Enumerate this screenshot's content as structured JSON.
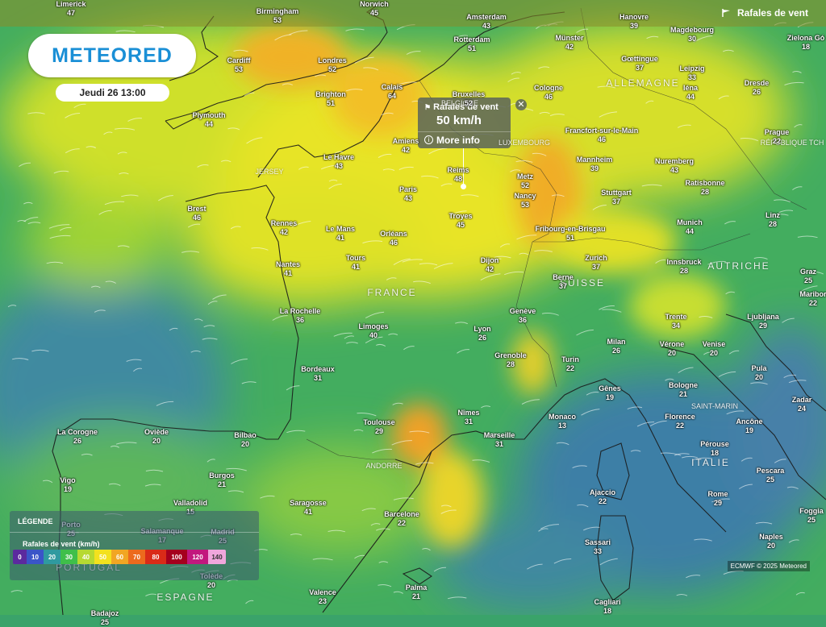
{
  "brand": "METEORED",
  "date_label": "Jeudi 26 13:00",
  "layer_label": "Rafales de vent",
  "tooltip": {
    "title": "Rafales de vent",
    "value": "50 km/h",
    "more": "More info"
  },
  "legend": {
    "title": "LÉGENDE",
    "subtitle": "Rafales de vent (km/h)",
    "scale": [
      {
        "label": "0",
        "color": "#5b2a9e"
      },
      {
        "label": "10",
        "color": "#3a55c8"
      },
      {
        "label": "20",
        "color": "#2f9aa0"
      },
      {
        "label": "30",
        "color": "#3fbf4a"
      },
      {
        "label": "40",
        "color": "#b6d931"
      },
      {
        "label": "50",
        "color": "#f3e11e"
      },
      {
        "label": "60",
        "color": "#f1a623"
      },
      {
        "label": "70",
        "color": "#ec6a1d"
      },
      {
        "label": "80",
        "color": "#d92b18"
      },
      {
        "label": "100",
        "color": "#a5001e"
      },
      {
        "label": "120",
        "color": "#c2187e"
      },
      {
        "label": "140",
        "color": "#f0a6dc"
      }
    ]
  },
  "credit": "ECMWF © 2025 Meteored",
  "countries": [
    "ALLEMAGNE",
    "FRANCE",
    "SUISSE",
    "AUTRICHE",
    "ITALIE",
    "ESPAGNE",
    "PORTUGAL",
    "RÉPUBLIQUE TCH",
    "LUXEMBOURG",
    "JERSEY",
    "ANDORRE",
    "SAINT-MARIN",
    "BELGIQUE"
  ],
  "cities": [
    {
      "name": "Limerick",
      "value": "47"
    },
    {
      "name": "Birmingham",
      "value": "53"
    },
    {
      "name": "Norwich",
      "value": "45"
    },
    {
      "name": "Amsterdam",
      "value": "43"
    },
    {
      "name": "Hanovre",
      "value": "39"
    },
    {
      "name": "Magdebourg",
      "value": "30"
    },
    {
      "name": "Zielona Gó",
      "value": "18"
    },
    {
      "name": "Cardiff",
      "value": "53"
    },
    {
      "name": "Londres",
      "value": "52"
    },
    {
      "name": "Rotterdam",
      "value": "51"
    },
    {
      "name": "Münster",
      "value": "42"
    },
    {
      "name": "Gœttingue",
      "value": "37"
    },
    {
      "name": "Leipzig",
      "value": "33"
    },
    {
      "name": "Dresde",
      "value": "26"
    },
    {
      "name": "Plymouth",
      "value": "44"
    },
    {
      "name": "Brighton",
      "value": "51"
    },
    {
      "name": "Calais",
      "value": "64"
    },
    {
      "name": "Bruxelles",
      "value": "52"
    },
    {
      "name": "Cologne",
      "value": "46"
    },
    {
      "name": "Iéna",
      "value": "44"
    },
    {
      "name": "Prague",
      "value": "22"
    },
    {
      "name": "Amiens",
      "value": "42"
    },
    {
      "name": "Francfort-sur-le-Main",
      "value": "46"
    },
    {
      "name": "Le Havre",
      "value": "43"
    },
    {
      "name": "Reims",
      "value": "48"
    },
    {
      "name": "Mannheim",
      "value": "39"
    },
    {
      "name": "Nuremberg",
      "value": "43"
    },
    {
      "name": "Metz",
      "value": "52"
    },
    {
      "name": "Ratisbonne",
      "value": "28"
    },
    {
      "name": "Brest",
      "value": "46"
    },
    {
      "name": "Paris",
      "value": "43"
    },
    {
      "name": "Nancy",
      "value": "53"
    },
    {
      "name": "Stuttgart",
      "value": "37"
    },
    {
      "name": "Linz",
      "value": "28"
    },
    {
      "name": "Rennes",
      "value": "42"
    },
    {
      "name": "Le Mans",
      "value": "41"
    },
    {
      "name": "Orléans",
      "value": "46"
    },
    {
      "name": "Troyes",
      "value": "45"
    },
    {
      "name": "Fribourg-en-Brisgau",
      "value": "51"
    },
    {
      "name": "Munich",
      "value": "44"
    },
    {
      "name": "Nantes",
      "value": "41"
    },
    {
      "name": "Tours",
      "value": "41"
    },
    {
      "name": "Dijon",
      "value": "42"
    },
    {
      "name": "Zurich",
      "value": "37"
    },
    {
      "name": "Innsbruck",
      "value": "28"
    },
    {
      "name": "Graz",
      "value": "25"
    },
    {
      "name": "Berne",
      "value": "37"
    },
    {
      "name": "Maribor",
      "value": "22"
    },
    {
      "name": "La Rochelle",
      "value": "36"
    },
    {
      "name": "Genève",
      "value": "36"
    },
    {
      "name": "Trente",
      "value": "34"
    },
    {
      "name": "Ljubljana",
      "value": "29"
    },
    {
      "name": "Limoges",
      "value": "40"
    },
    {
      "name": "Lyon",
      "value": "26"
    },
    {
      "name": "Milan",
      "value": "26"
    },
    {
      "name": "Vérone",
      "value": "20"
    },
    {
      "name": "Venise",
      "value": "20"
    },
    {
      "name": "Grenoble",
      "value": "28"
    },
    {
      "name": "Bordeaux",
      "value": "31"
    },
    {
      "name": "Turin",
      "value": "22"
    },
    {
      "name": "Pula",
      "value": "20"
    },
    {
      "name": "Gênes",
      "value": "19"
    },
    {
      "name": "Bologne",
      "value": "21"
    },
    {
      "name": "Zadar",
      "value": "24"
    },
    {
      "name": "Nîmes",
      "value": "31"
    },
    {
      "name": "Monaco",
      "value": "13"
    },
    {
      "name": "Florence",
      "value": "22"
    },
    {
      "name": "Ancône",
      "value": "19"
    },
    {
      "name": "La Corogne",
      "value": "26"
    },
    {
      "name": "Oviède",
      "value": "20"
    },
    {
      "name": "Toulouse",
      "value": "29"
    },
    {
      "name": "Marseille",
      "value": "31"
    },
    {
      "name": "Bilbao",
      "value": "20"
    },
    {
      "name": "Pérouse",
      "value": "18"
    },
    {
      "name": "Vigo",
      "value": "19"
    },
    {
      "name": "Burgos",
      "value": "21"
    },
    {
      "name": "Pescara",
      "value": "25"
    },
    {
      "name": "Valladolid",
      "value": "15"
    },
    {
      "name": "Saragosse",
      "value": "41"
    },
    {
      "name": "Ajaccio",
      "value": "22"
    },
    {
      "name": "Rome",
      "value": "29"
    },
    {
      "name": "Foggia",
      "value": "25"
    },
    {
      "name": "Porto",
      "value": "25"
    },
    {
      "name": "Barcelone",
      "value": "22"
    },
    {
      "name": "Salamanque",
      "value": "17"
    },
    {
      "name": "Naples",
      "value": "20"
    },
    {
      "name": "Madrid",
      "value": "25"
    },
    {
      "name": "Sassari",
      "value": "33"
    },
    {
      "name": "Tolède",
      "value": "20"
    },
    {
      "name": "Palma",
      "value": "21"
    },
    {
      "name": "Valence",
      "value": "23"
    },
    {
      "name": "Badajoz",
      "value": "25"
    },
    {
      "name": "Cagliari",
      "value": "18"
    }
  ]
}
